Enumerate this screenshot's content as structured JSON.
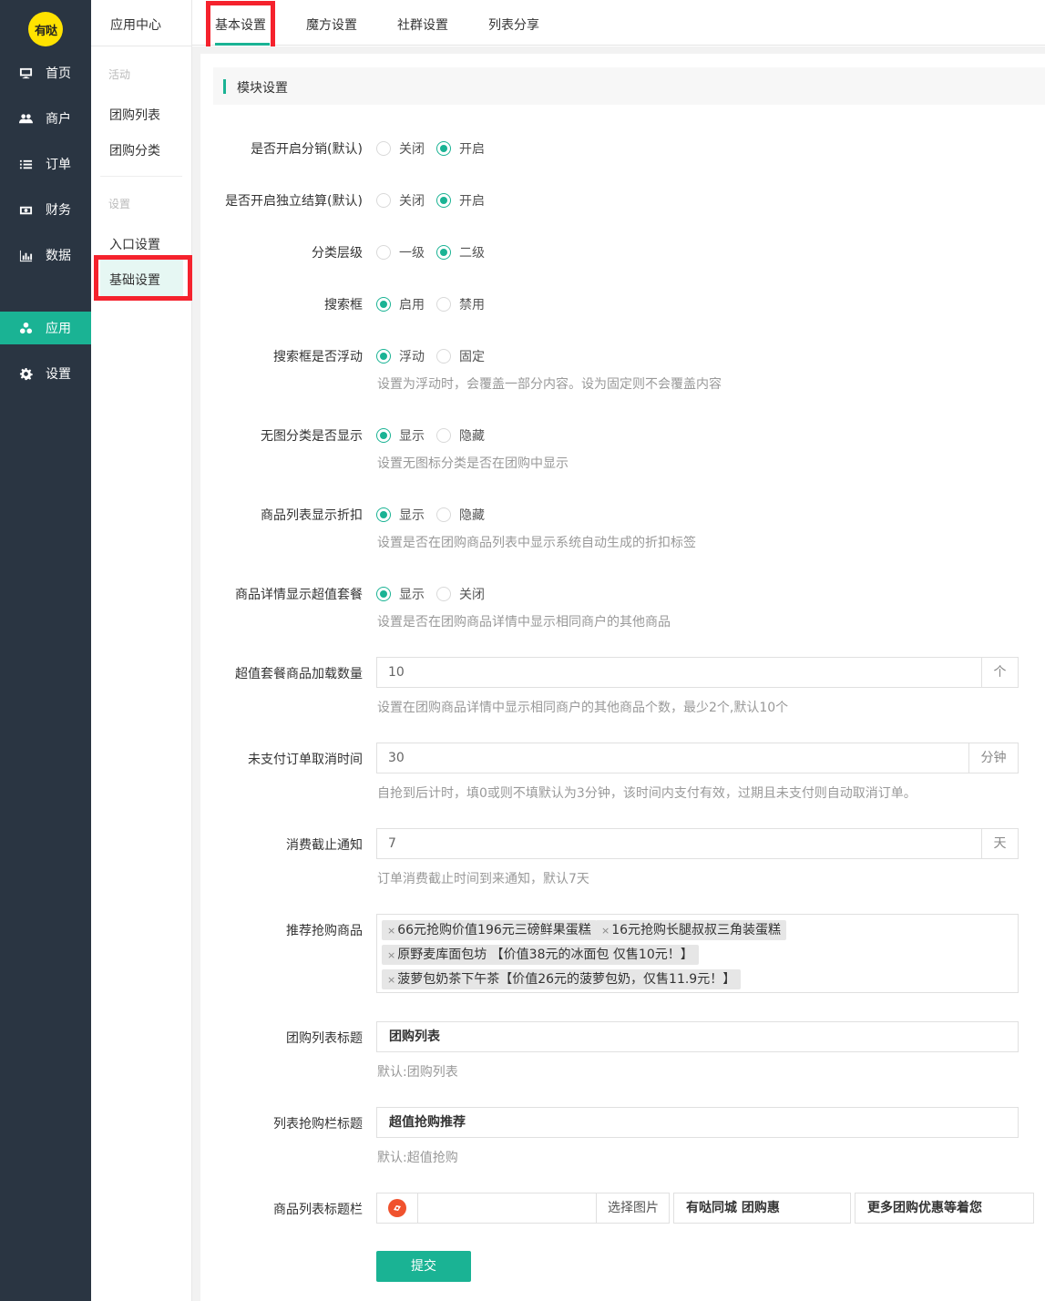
{
  "logo_text": "有哒",
  "nav": [
    {
      "label": "首页",
      "icon": "monitor-icon"
    },
    {
      "label": "商户",
      "icon": "users-icon"
    },
    {
      "label": "订单",
      "icon": "list-icon"
    },
    {
      "label": "财务",
      "icon": "money-icon"
    },
    {
      "label": "数据",
      "icon": "bar-chart-icon"
    },
    {
      "label": "应用",
      "icon": "apps-icon",
      "active": true
    },
    {
      "label": "设置",
      "icon": "gear-icon"
    }
  ],
  "submenu": {
    "title": "应用中心",
    "group1": "活动",
    "items1": [
      "团购列表",
      "团购分类"
    ],
    "group2": "设置",
    "items2": [
      "入口设置",
      "基础设置"
    ]
  },
  "tabs": [
    "基本设置",
    "魔方设置",
    "社群设置",
    "列表分享"
  ],
  "section_title": "模块设置",
  "form": {
    "r1": {
      "label": "是否开启分销(默认)",
      "opts": [
        "关闭",
        "开启"
      ],
      "selected": 1
    },
    "r2": {
      "label": "是否开启独立结算(默认)",
      "opts": [
        "关闭",
        "开启"
      ],
      "selected": 1
    },
    "r3": {
      "label": "分类层级",
      "opts": [
        "一级",
        "二级"
      ],
      "selected": 1
    },
    "r4": {
      "label": "搜索框",
      "opts": [
        "启用",
        "禁用"
      ],
      "selected": 0
    },
    "r5": {
      "label": "搜索框是否浮动",
      "opts": [
        "浮动",
        "固定"
      ],
      "selected": 0,
      "help": "设置为浮动时，会覆盖一部分内容。设为固定则不会覆盖内容"
    },
    "r6": {
      "label": "无图分类是否显示",
      "opts": [
        "显示",
        "隐藏"
      ],
      "selected": 0,
      "help": "设置无图标分类是否在团购中显示"
    },
    "r7": {
      "label": "商品列表显示折扣",
      "opts": [
        "显示",
        "隐藏"
      ],
      "selected": 0,
      "help": "设置是否在团购商品列表中显示系统自动生成的折扣标签"
    },
    "r8": {
      "label": "商品详情显示超值套餐",
      "opts": [
        "显示",
        "关闭"
      ],
      "selected": 0,
      "help": "设置是否在团购商品详情中显示相同商户的其他商品"
    },
    "i1": {
      "label": "超值套餐商品加载数量",
      "value": "10",
      "addon": "个",
      "help": "设置在团购商品详情中显示相同商户的其他商品个数，最少2个,默认10个"
    },
    "i2": {
      "label": "未支付订单取消时间",
      "value": "30",
      "addon": "分钟",
      "help": "自抢到后计时，填0或则不填默认为3分钟，该时间内支付有效，过期且未支付则自动取消订单。"
    },
    "i3": {
      "label": "消费截止通知",
      "value": "7",
      "addon": "天",
      "help": "订单消费截止时间到来通知，默认7天"
    },
    "tags": {
      "label": "推荐抢购商品",
      "items": [
        "66元抢购价值196元三磅鲜果蛋糕",
        "16元抢购长腿叔叔三角装蛋糕",
        "原野麦库面包坊 【价值38元的冰面包 仅售10元！】",
        "菠萝包奶茶下午茶【价值26元的菠萝包奶，仅售11.9元！】"
      ]
    },
    "t1": {
      "label": "团购列表标题",
      "value": "团购列表",
      "help": "默认:团购列表"
    },
    "t2": {
      "label": "列表抢购栏标题",
      "value": "超值抢购推荐",
      "help": "默认:超值抢购"
    },
    "tb": {
      "label": "商品列表标题栏",
      "choose": "选择图片",
      "text1": "有哒同城 团购惠",
      "text2": "更多团购优惠等着您"
    }
  },
  "submit": "提交",
  "colors": {
    "accent": "#1ab394",
    "nav_bg": "#2a3542",
    "highlight": "#f5222d"
  }
}
